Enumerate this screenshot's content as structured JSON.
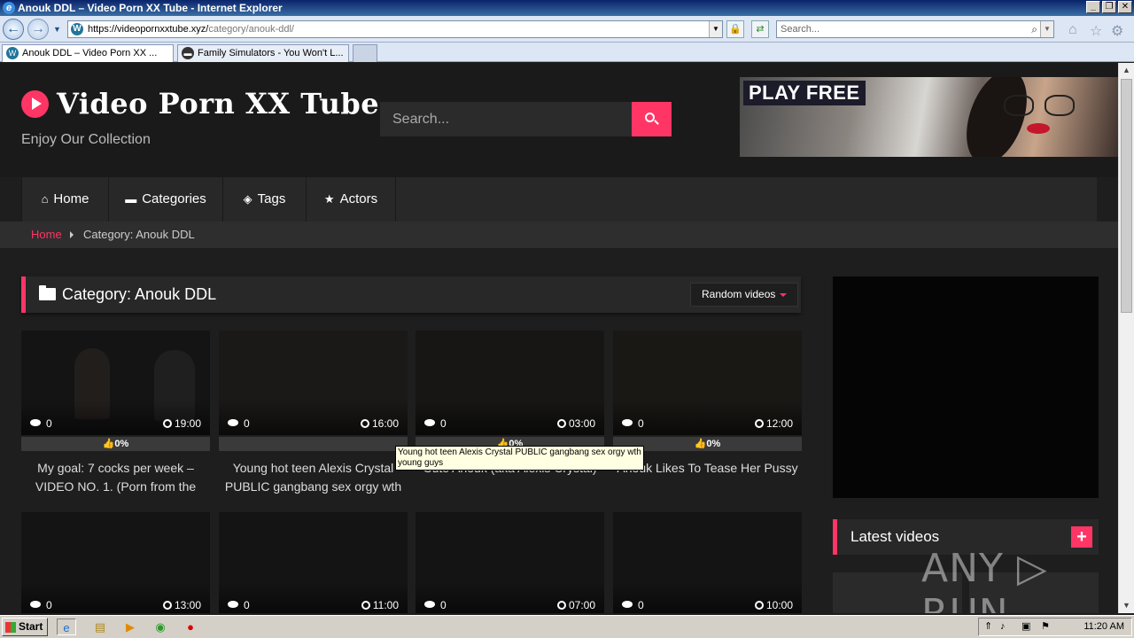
{
  "window": {
    "title": "Anouk DDL – Video Porn XX Tube - Internet Explorer",
    "controls": [
      "_",
      "❐",
      "✕"
    ]
  },
  "browser": {
    "url_host": "https://videopornxxtube.xyz/",
    "url_path": "category/anouk-ddl/",
    "search_placeholder": "Search...",
    "tabs": [
      {
        "label": "Anouk DDL – Video Porn XX ...",
        "active": true
      },
      {
        "label": "Family Simulators - You Won't L...",
        "active": false
      }
    ]
  },
  "site": {
    "title": "Video Porn XX Tube",
    "tagline": "Enjoy Our Collection",
    "search_placeholder": "Search...",
    "banner_text": "PLAY FREE",
    "accent_color": "#ff3565"
  },
  "nav": [
    {
      "label": "Home",
      "icon": "home-icon"
    },
    {
      "label": "Categories",
      "icon": "folder-icon"
    },
    {
      "label": "Tags",
      "icon": "tags-icon"
    },
    {
      "label": "Actors",
      "icon": "star-icon"
    }
  ],
  "breadcrumb": {
    "home": "Home",
    "current": "Category: Anouk DDL"
  },
  "category": {
    "title": "Category: Anouk DDL",
    "sort_label": "Random videos"
  },
  "videos": [
    {
      "views": "0",
      "duration": "19:00",
      "rating": "0%",
      "title": "My goal: 7 cocks per week – VIDEO NO. 1. (Porn from the"
    },
    {
      "views": "0",
      "duration": "16:00",
      "rating": "",
      "title": "Young hot teen Alexis Crystal PUBLIC gangbang sex orgy wth"
    },
    {
      "views": "0",
      "duration": "03:00",
      "rating": "0%",
      "title": "Cute Anouk (aka Alexis Crystal)"
    },
    {
      "views": "0",
      "duration": "12:00",
      "rating": "0%",
      "title": "Anouk Likes To Tease Her Pussy"
    },
    {
      "views": "0",
      "duration": "13:00",
      "rating": "",
      "title": ""
    },
    {
      "views": "0",
      "duration": "11:00",
      "rating": "",
      "title": ""
    },
    {
      "views": "0",
      "duration": "07:00",
      "rating": "",
      "title": ""
    },
    {
      "views": "0",
      "duration": "10:00",
      "rating": "",
      "title": ""
    }
  ],
  "tooltip": "Young hot teen Alexis Crystal PUBLIC gangbang sex orgy wth young guys",
  "sidebar": {
    "latest_title": "Latest videos",
    "latest_button": "+"
  },
  "watermark": "ANY ▷ RUN",
  "taskbar": {
    "start_label": "Start",
    "clock": "11:20 AM"
  }
}
